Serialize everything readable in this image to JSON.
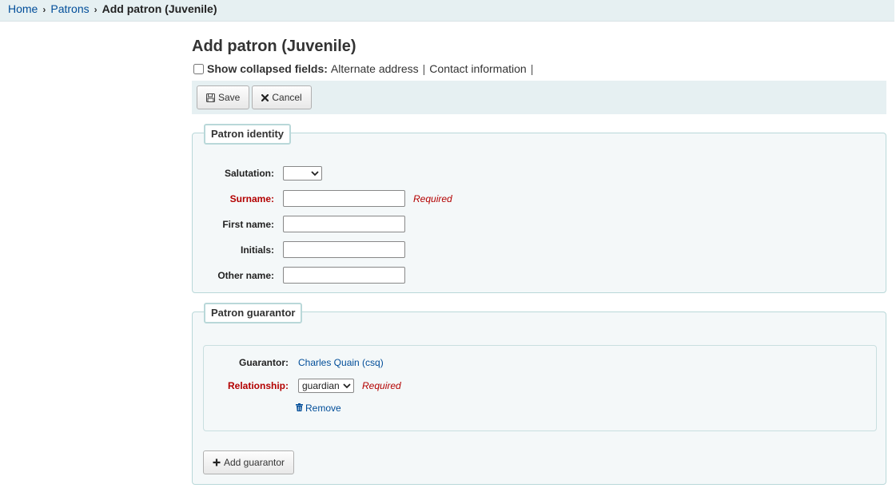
{
  "breadcrumb": {
    "home": "Home",
    "patrons": "Patrons",
    "current": "Add patron (Juvenile)"
  },
  "page": {
    "title": "Add patron (Juvenile)"
  },
  "collapsed": {
    "label": "Show collapsed fields:",
    "alternate_address": "Alternate address",
    "contact_information": "Contact information",
    "sep": "|"
  },
  "toolbar": {
    "save_label": "Save",
    "cancel_label": "Cancel"
  },
  "identity": {
    "legend": "Patron identity",
    "salutation_label": "Salutation:",
    "salutation_value": "",
    "surname_label": "Surname:",
    "surname_value": "",
    "surname_required": "Required",
    "firstname_label": "First name:",
    "firstname_value": "",
    "initials_label": "Initials:",
    "initials_value": "",
    "othername_label": "Other name:",
    "othername_value": ""
  },
  "guarantor": {
    "legend": "Patron guarantor",
    "guarantor_label": "Guarantor:",
    "guarantor_name": "Charles Quain (csq)",
    "relationship_label": "Relationship:",
    "relationship_value": "guardian",
    "relationship_required": "Required",
    "remove_label": "Remove",
    "add_label": "Add guarantor"
  },
  "colors": {
    "link": "#004d99",
    "required": "#b30000",
    "panel_bg": "#e6f0f2",
    "fieldset_border": "#b9d8d9"
  },
  "icons": {
    "save": "floppy-disk-icon",
    "cancel": "x-mark-icon",
    "remove": "trash-icon",
    "add": "plus-icon",
    "select": "chevron-down-icon",
    "breadcrumb_sep": "chevron-right-icon"
  }
}
